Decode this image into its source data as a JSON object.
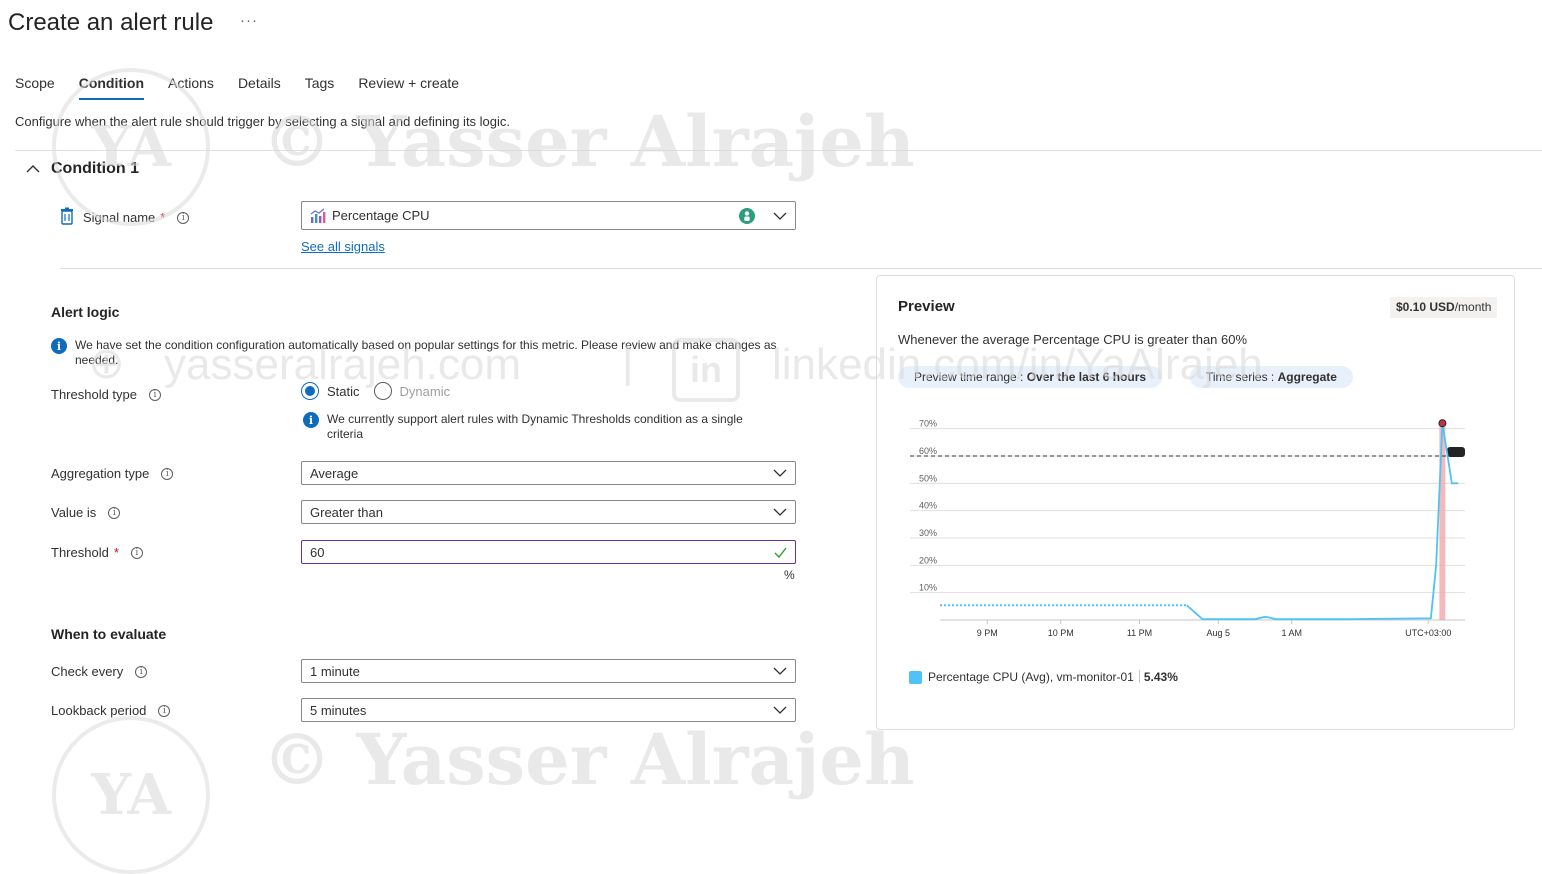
{
  "header": {
    "title": "Create an alert rule",
    "more": "···"
  },
  "tabs": [
    {
      "label": "Scope"
    },
    {
      "label": "Condition",
      "active": true
    },
    {
      "label": "Actions"
    },
    {
      "label": "Details"
    },
    {
      "label": "Tags"
    },
    {
      "label": "Review + create"
    }
  ],
  "description": "Configure when the alert rule should trigger by selecting a signal and defining its logic.",
  "condition": {
    "title": "Condition 1",
    "signal": {
      "label": "Signal name",
      "value": "Percentage CPU",
      "see_all": "See all signals"
    },
    "alert_logic": {
      "heading": "Alert logic",
      "info_message": "We have set the condition configuration automatically based on popular settings for this metric. Please review and make changes as needed.",
      "threshold_type": {
        "label": "Threshold type",
        "options": [
          "Static",
          "Dynamic"
        ],
        "selected": "Static",
        "info": "We currently support alert rules with Dynamic Thresholds condition as a single criteria"
      },
      "aggregation_type": {
        "label": "Aggregation type",
        "value": "Average"
      },
      "value_is": {
        "label": "Value is",
        "value": "Greater than"
      },
      "threshold": {
        "label": "Threshold",
        "value": "60",
        "unit": "%"
      }
    },
    "when_to_evaluate": {
      "heading": "When to evaluate",
      "check_every": {
        "label": "Check every",
        "value": "1 minute"
      },
      "lookback_period": {
        "label": "Lookback period",
        "value": "5 minutes"
      }
    }
  },
  "preview": {
    "title": "Preview",
    "price_value": "$0.10 USD",
    "price_unit": "/month",
    "summary": "Whenever the average Percentage CPU is greater than 60%",
    "time_range_label": "Preview time range : ",
    "time_range_value": "Over the last 6 hours",
    "time_series_label": "Time series : ",
    "time_series_value": "Aggregate",
    "legend": {
      "name": "Percentage CPU (Avg), vm-monitor-01",
      "value": "5.43%"
    }
  },
  "watermark": {
    "line1": "© Yasser Alrajeh",
    "line2_left": "yasseralrajeh.com",
    "line2_right": "linkedin.com/in/YaAlrajeh",
    "monogram": "YA",
    "in_logo": "in"
  },
  "colors": {
    "accent": "#0f6cbd",
    "series": "#4fc3f7",
    "threshold_band": "#f4a8a8"
  },
  "chart_data": {
    "type": "line",
    "y_ticks": [
      "10%",
      "20%",
      "30%",
      "40%",
      "50%",
      "60%",
      "70%"
    ],
    "ylim": [
      0,
      75
    ],
    "threshold": 60,
    "x_ticks": [
      "9 PM",
      "10 PM",
      "11 PM",
      "Aug 5",
      "1 AM",
      "UTC+03:00"
    ],
    "series": [
      {
        "name": "Percentage CPU (Avg), vm-monitor-01",
        "points_dotted": [
          [
            0,
            5.4
          ],
          [
            0.47,
            5.4
          ]
        ],
        "points": [
          [
            0.47,
            5.4
          ],
          [
            0.5,
            0.3
          ],
          [
            0.6,
            0.3
          ],
          [
            0.62,
            1.2
          ],
          [
            0.64,
            0.3
          ],
          [
            0.78,
            0.3
          ],
          [
            0.92,
            0.6
          ],
          [
            0.935,
            0.6
          ],
          [
            0.945,
            20
          ],
          [
            0.957,
            72
          ],
          [
            0.975,
            50
          ],
          [
            0.987,
            50
          ]
        ]
      }
    ],
    "x_tick_pos": [
      0.09,
      0.23,
      0.38,
      0.53,
      0.67,
      0.93
    ]
  }
}
